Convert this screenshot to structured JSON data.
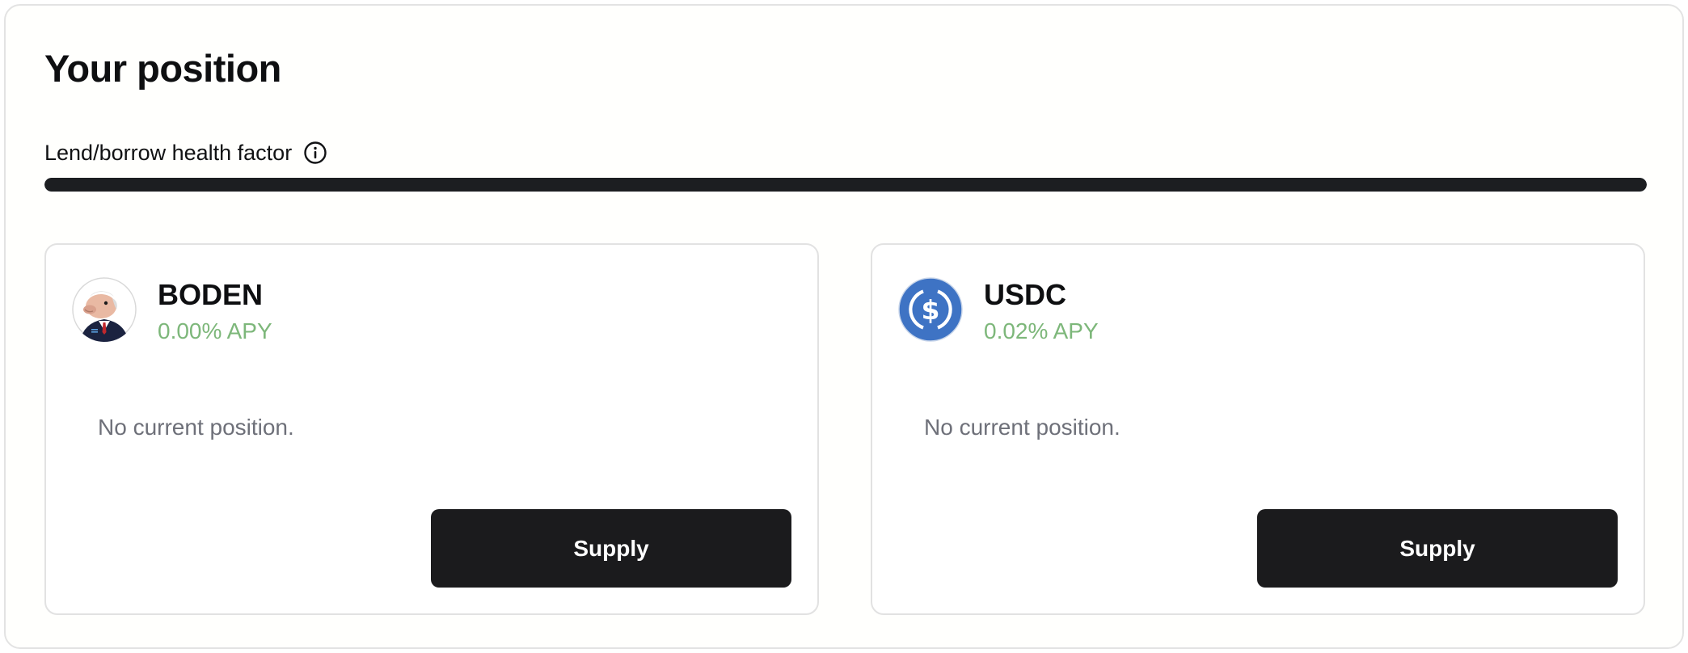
{
  "position": {
    "title": "Your position",
    "health_factor": {
      "label": "Lend/borrow health factor",
      "info_icon": "info-icon",
      "fill_fraction": 1.0,
      "fill_color": "#1c1e21"
    }
  },
  "assets": [
    {
      "symbol": "BODEN",
      "apy": "0.00% APY",
      "icon": "boden-token-logo",
      "status": "No current position.",
      "action_label": "Supply"
    },
    {
      "symbol": "USDC",
      "apy": "0.02% APY",
      "icon": "usdc-token-logo",
      "status": "No current position.",
      "action_label": "Supply"
    }
  ],
  "colors": {
    "apy_green": "#7db77a",
    "button_bg": "#1b1b1d",
    "usdc_blue": "#3e73c4"
  }
}
